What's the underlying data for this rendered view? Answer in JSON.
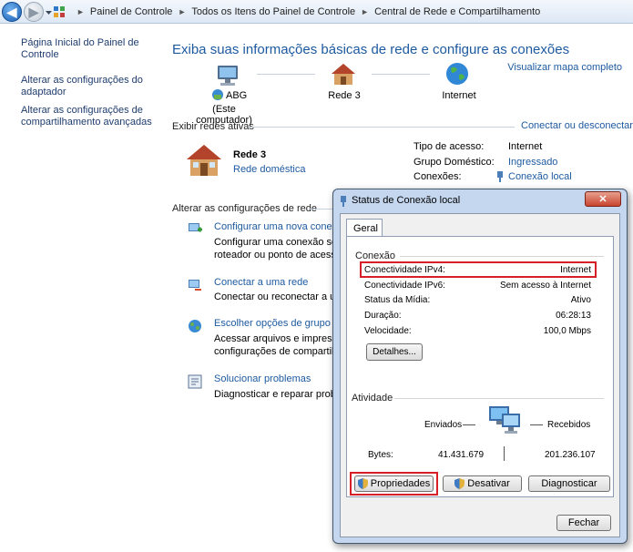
{
  "breadcrumb": [
    "Painel de Controle",
    "Todos os Itens do Painel de Controle",
    "Central de Rede e Compartilhamento"
  ],
  "sidebar": {
    "items": [
      {
        "label_line1": "Página Inicial do Painel de",
        "label_line2": "Controle"
      },
      {
        "label_line1": "Alterar as configurações do",
        "label_line2": "adaptador"
      },
      {
        "label_line1": "Alterar as configurações de",
        "label_line2": "compartilhamento avançadas"
      }
    ]
  },
  "main": {
    "title": "Exiba suas informações básicas de rede e configure as conexões",
    "view_full_map": "Visualizar mapa completo",
    "map": {
      "computer_name": "ABG",
      "computer_sub": "(Este computador)",
      "network_name": "Rede  3",
      "internet": "Internet"
    },
    "active_networks": {
      "heading": "Exibir redes ativas",
      "connect_disconnect": "Conectar ou desconectar",
      "network_title": "Rede  3",
      "network_type": "Rede doméstica",
      "access_type_label": "Tipo de acesso:",
      "access_type_value": "Internet",
      "homegroup_label": "Grupo Doméstico:",
      "homegroup_value": "Ingressado",
      "connections_label": "Conexões:",
      "connections_value": "Conexão local"
    },
    "change_settings": {
      "heading": "Alterar as configurações de rede",
      "items": [
        {
          "title": "Configurar uma nova conexã",
          "desc1": "Configurar uma conexão sem",
          "desc2": "roteador ou ponto de acesso"
        },
        {
          "title": "Conectar a uma rede",
          "desc1": "Conectar ou reconectar a um",
          "desc2": ""
        },
        {
          "title": "Escolher opções de grupo do",
          "desc1": "Acessar arquivos e impressor",
          "desc2": "configurações de compartilh"
        },
        {
          "title": "Solucionar problemas",
          "desc1": "Diagnosticar e reparar proble",
          "desc2": ""
        }
      ]
    }
  },
  "dialog": {
    "title": "Status de Conexão local",
    "close": "✕",
    "tab": "Geral",
    "connection_group": "Conexão",
    "rows": [
      {
        "label": "Conectividade IPv4:",
        "value": "Internet"
      },
      {
        "label": "Conectividade IPv6:",
        "value": "Sem acesso à Internet"
      },
      {
        "label": "Status da Mídia:",
        "value": "Ativo"
      },
      {
        "label": "Duração:",
        "value": "06:28:13"
      },
      {
        "label": "Velocidade:",
        "value": "100,0 Mbps"
      }
    ],
    "details_button": "Detalhes...",
    "activity_group": "Atividade",
    "sent_label": "Enviados",
    "received_label": "Recebidos",
    "bytes_label": "Bytes:",
    "bytes_sent": "41.431.679",
    "bytes_received": "201.236.107",
    "properties_button": "Propriedades",
    "disable_button": "Desativar",
    "diagnose_button": "Diagnosticar",
    "close_button": "Fechar"
  },
  "colors": {
    "link": "#1e5aa0",
    "highlight": "#d71f28",
    "title_bar": "#c5d7ef"
  }
}
